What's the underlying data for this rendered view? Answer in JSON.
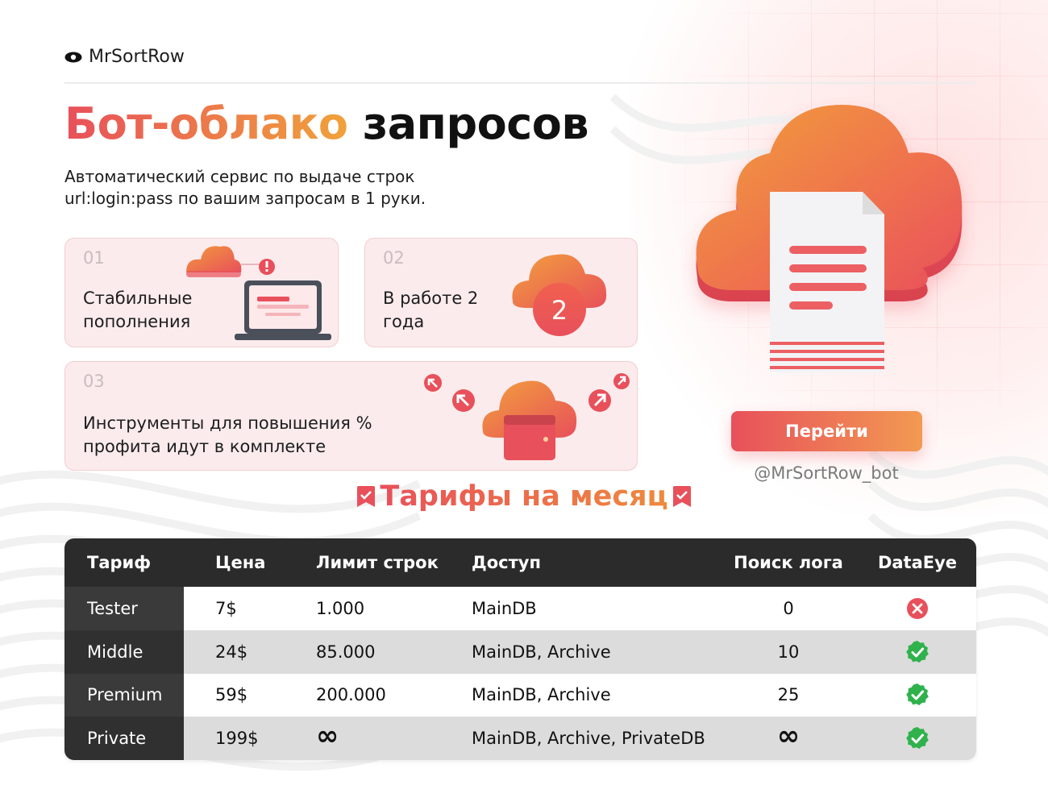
{
  "brand": {
    "name": "MrSortRow"
  },
  "headline": {
    "highlight": "Бот-облако",
    "rest": "запросов"
  },
  "subtitle": "Автоматический сервис по выдаче строк url:login:pass по вашим запросам в 1 руки.",
  "features": [
    {
      "num": "01",
      "text": "Стабильные пополнения"
    },
    {
      "num": "02",
      "text": "В работе 2 года",
      "badge": "2"
    },
    {
      "num": "03",
      "text": "Инструменты для повышения % профита идут в комплекте"
    }
  ],
  "cta": {
    "label": "Перейти",
    "handle": "@MrSortRow_bot"
  },
  "tariffs": {
    "title": "Тарифы на месяц",
    "headers": [
      "Тариф",
      "Цена",
      "Лимит строк",
      "Доступ",
      "Поиск лога",
      "DataEye"
    ],
    "rows": [
      {
        "name": "Tester",
        "price": "7$",
        "limit": "1.000",
        "access": "MainDB",
        "log_search": "0",
        "dataeye": false
      },
      {
        "name": "Middle",
        "price": "24$",
        "limit": "85.000",
        "access": "MainDB, Archive",
        "log_search": "10",
        "dataeye": true
      },
      {
        "name": "Premium",
        "price": "59$",
        "limit": "200.000",
        "access": "MainDB, Archive",
        "log_search": "25",
        "dataeye": true
      },
      {
        "name": "Private",
        "price": "199$",
        "limit": "∞",
        "access": "MainDB, Archive, PrivateDB",
        "log_search": "∞",
        "dataeye": true
      }
    ]
  },
  "icons": {
    "brand": "eye-icon",
    "hero": "cloud-document-icon",
    "card1": "cloud-laptop-icon",
    "card2": "cloud-badge-icon",
    "card3": "cloud-wallet-icon",
    "title": "bookmark-check-icon",
    "yes": "green-check-icon",
    "no": "red-cross-icon"
  },
  "colors": {
    "accent_red": "#e8505b",
    "accent_orange": "#f0a23a",
    "table_header": "#2b2b2b",
    "check_green": "#2fb24c",
    "cross_red": "#e8505b"
  }
}
